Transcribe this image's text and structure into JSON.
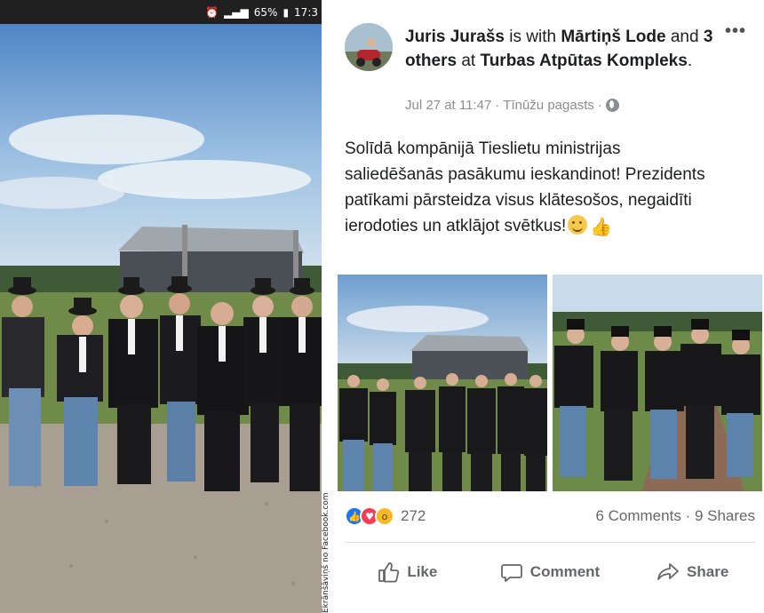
{
  "status_bar": {
    "battery": "65%",
    "time": "17:3",
    "signal_icons": [
      "alarm-icon",
      "data-icon",
      "signal-icon",
      "battery-icon"
    ]
  },
  "credit": "Ekrānšāviņš no Facebook.com",
  "post": {
    "author": "Juris Jurašs",
    "is_with_text": "is with",
    "tagged": "Mārtiņš Lode",
    "and_text": "and",
    "others": "3 others",
    "at_text": "at",
    "place": "Turbas Atpūtas Kompleks",
    "date": "Jul 27 at 11:47",
    "location": "Tīnūžu pagasts",
    "text": "Solīdā kompānijā Tieslietu ministrijas saliedēšanās pasākumu ieskandinot! Prezidents patīkami pārsteidza visus klātesošos, negaidīti ierodoties un atklājot svētkus!",
    "reaction_count": "272",
    "comments": "6 Comments",
    "shares": "9 Shares",
    "actions": {
      "like": "Like",
      "comment": "Comment",
      "share": "Share"
    }
  },
  "colors": {
    "facebook_blue": "#1877f2",
    "text_dark": "#1c1e21",
    "text_gray": "#65676b"
  }
}
